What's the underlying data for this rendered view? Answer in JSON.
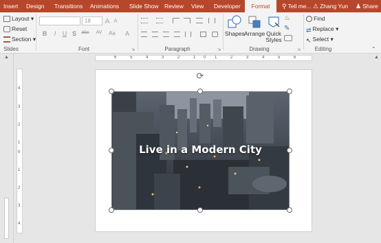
{
  "tabs": [
    {
      "label": "Insert",
      "active": false
    },
    {
      "label": "Design",
      "active": false
    },
    {
      "label": "Transitions",
      "active": false
    },
    {
      "label": "Animations",
      "active": false
    },
    {
      "label": "Slide Show",
      "active": false
    },
    {
      "label": "Review",
      "active": false
    },
    {
      "label": "View",
      "active": false
    },
    {
      "label": "Developer",
      "active": false
    },
    {
      "label": "Format",
      "active": true
    }
  ],
  "tell_me": "Tell me...",
  "user": {
    "name": "Zhang Yun",
    "warning_icon": "warning-icon"
  },
  "share_label": "Share",
  "slides_group": {
    "layout_label": "Layout",
    "reset_label": "Reset",
    "section_label": "Section",
    "group_label": "Slides"
  },
  "font_group": {
    "font_name": "",
    "font_size": "18",
    "group_label": "Font",
    "format_buttons": [
      "B",
      "I",
      "U",
      "S",
      "abc",
      "AV",
      "Aa",
      "A"
    ]
  },
  "paragraph_group": {
    "group_label": "Paragraph"
  },
  "drawing_group": {
    "shapes_label": "Shapes",
    "arrange_label": "Arrange",
    "quick_styles_label": "Quick Styles",
    "group_label": "Drawing"
  },
  "editing_group": {
    "find_label": "Find",
    "replace_label": "Replace",
    "select_label": "Select",
    "group_label": "Editing"
  },
  "ruler_h": [
    "6",
    "5",
    "4",
    "3",
    "2",
    "1",
    "0",
    "1",
    "2",
    "3",
    "4",
    "5",
    "6"
  ],
  "ruler_v": [
    "4",
    "3",
    "2",
    "1",
    "0",
    "1",
    "2",
    "3",
    "4"
  ],
  "slide": {
    "title": "Live in a Modern City"
  },
  "colors": {
    "accent": "#b7472a",
    "ribbon": "#f3f3f3",
    "canvas": "#e6e6e6"
  }
}
